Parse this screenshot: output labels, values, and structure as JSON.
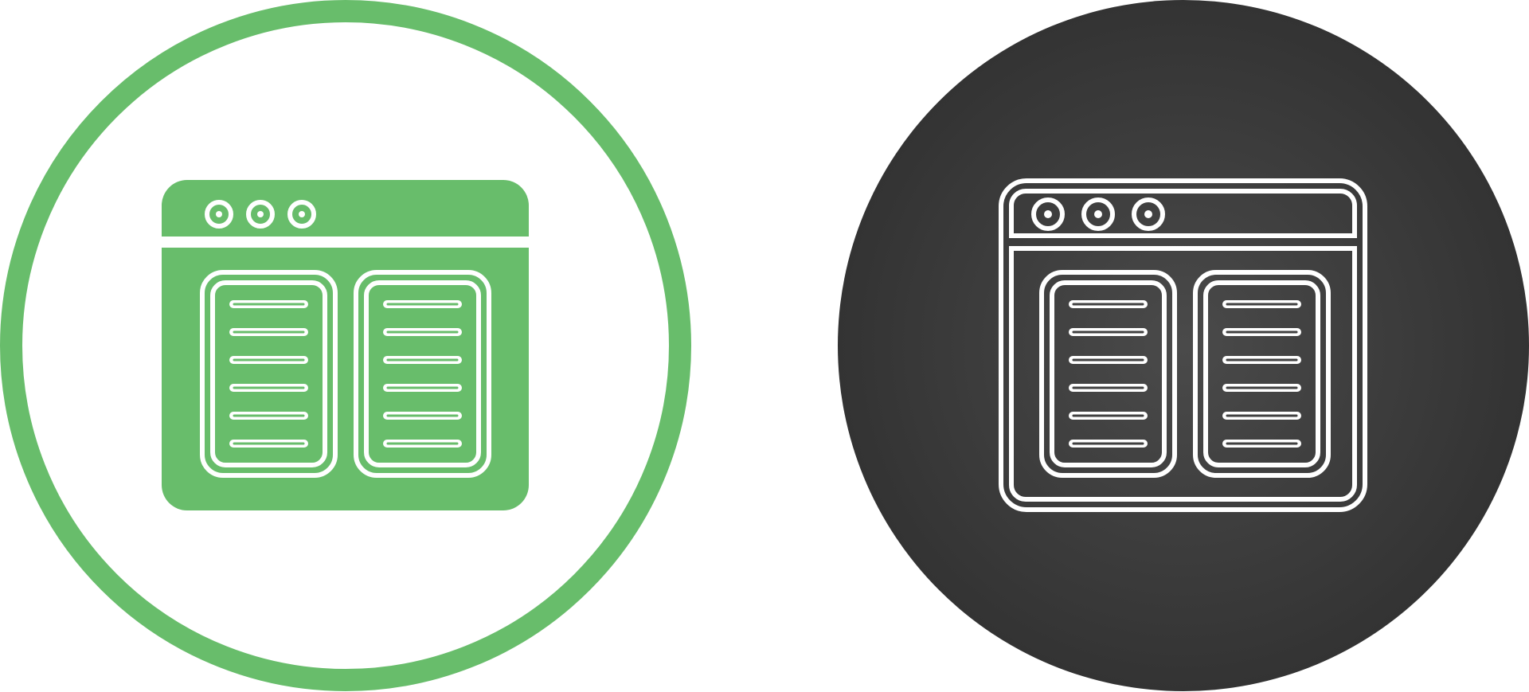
{
  "icons": [
    {
      "name": "browser-split-columns-icon-light",
      "variant": "green-on-white",
      "colors": {
        "ring": "#68bd6b",
        "background": "#ffffff",
        "glyph_fill": "#68bd6b",
        "glyph_line": "#ffffff"
      },
      "window_dots": 3,
      "panels": 2,
      "lines_per_panel": 6
    },
    {
      "name": "browser-split-columns-icon-dark",
      "variant": "white-on-dark",
      "colors": {
        "background_center": "#4a4a4a",
        "background_edge": "#333333",
        "glyph_line": "#ffffff"
      },
      "window_dots": 3,
      "panels": 2,
      "lines_per_panel": 6
    }
  ]
}
